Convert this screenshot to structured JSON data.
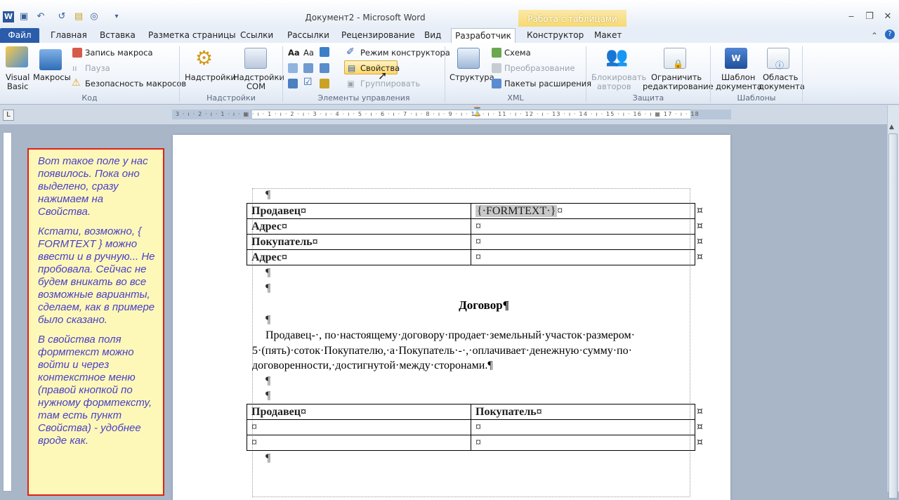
{
  "titlebar": {
    "title": "Документ2 - Microsoft Word",
    "context_tab": "Работа с таблицами",
    "qat": [
      "word-icon",
      "save-icon",
      "undo-icon",
      "redo-icon",
      "open-icon",
      "print-preview-icon",
      "customize-icon"
    ]
  },
  "tabs": {
    "file": "Файл",
    "home": "Главная",
    "insert": "Вставка",
    "layout": "Разметка страницы",
    "refs": "Ссылки",
    "mail": "Рассылки",
    "review": "Рецензирование",
    "view": "Вид",
    "developer": "Разработчик",
    "design": "Конструктор",
    "tlayout": "Макет"
  },
  "ribbon": {
    "code": {
      "visual_basic_1": "Visual",
      "visual_basic_2": "Basic",
      "macros": "Макросы",
      "record": "Запись макроса",
      "pause": "Пауза",
      "security": "Безопасность макросов",
      "group": "Код"
    },
    "addins": {
      "addins": "Надстройки",
      "com_1": "Надстройки",
      "com_2": "COM",
      "group": "Надстройки"
    },
    "controls": {
      "design_mode": "Режим конструктора",
      "properties": "Свойства",
      "group_btn": "Группировать",
      "group": "Элементы управления"
    },
    "xml": {
      "structure": "Структура",
      "schema": "Схема",
      "transform": "Преобразование",
      "packs": "Пакеты расширения",
      "group": "XML"
    },
    "protect": {
      "block_1": "Блокировать",
      "block_2": "авторов",
      "restrict_1": "Ограничить",
      "restrict_2": "редактирование",
      "group": "Защита"
    },
    "templates": {
      "tpl_1": "Шаблон",
      "tpl_2": "документа",
      "area_1": "Область",
      "area_2": "документа",
      "group": "Шаблоны"
    }
  },
  "ruler": {
    "numbers": "3 · ı · 2 · ı · 1 · ı · ▦ · ı · 1 · ı · 2 · ı · 3 · ı · 4 · ı · 5 · ı · 6 · ı · 7 · ı · 8 · ı · 9 · ı · 10 · ı · 11 · ı · 12 · ı · 13 · ı · 14 · ı · 15 · ı · 16 · ı ▦ 17 · ı · 18",
    "corner": "L"
  },
  "note": {
    "p1": "Вот такое поле у нас появилось. Пока оно выделено, сразу нажимаем на Свойства.",
    "p2": "Кстати, возможно, { FORMTEXT } можно ввести и в ручную... Не пробовала. Сейчас не будем вникать во все возможные варианты, сделаем, как в примере было сказано.",
    "p3": "В свойства поля формтекст можно войти и через контекстное меню (правой кнопкой по нужному формтексту, там есть пункт Свойства) - удобнее вроде как."
  },
  "doc": {
    "pilcrow": "¶",
    "cellmark": "¤",
    "table1": [
      {
        "label": "Продавец¤",
        "value": "{·FORMTEXT·}"
      },
      {
        "label": "Адрес¤",
        "value": "¤"
      },
      {
        "label": "Покупатель¤",
        "value": "¤"
      },
      {
        "label": "Адрес¤",
        "value": "¤"
      }
    ],
    "heading": "Договор¶",
    "body_1": "Продавец-·, по·настоящему·договору·продает·земельный·участок·размером·",
    "body_2": "5·(пять)·соток·Покупателю,·а·Покупатель·-·,·оплачивает·денежную·сумму·по·",
    "body_3": "договоренности,·достигнутой·между·сторонами.¶",
    "table2_header": [
      "Продавец¤",
      "Покупатель¤"
    ],
    "table2_rows": [
      [
        "¤",
        "¤"
      ],
      [
        "¤",
        "¤"
      ]
    ]
  }
}
